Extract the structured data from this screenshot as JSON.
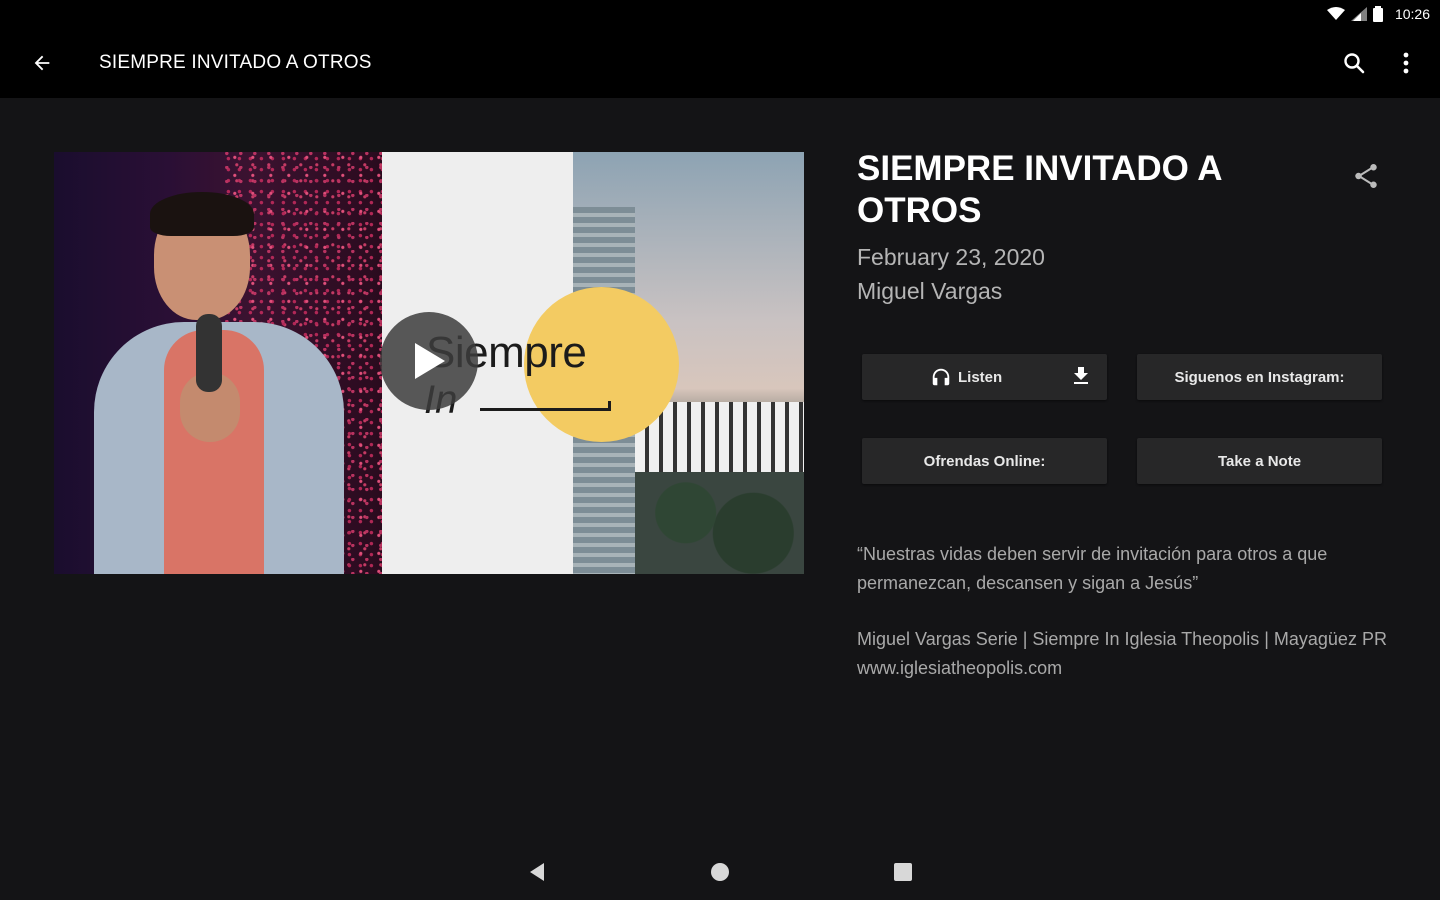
{
  "status_bar": {
    "time": "10:26"
  },
  "app_bar": {
    "title": "SIEMPRE INVITADO A OTROS"
  },
  "hero": {
    "word1": "Siempre",
    "word2": "In"
  },
  "sermon": {
    "title": "SIEMPRE INVITADO A OTROS",
    "date": "February 23, 2020",
    "speaker": "Miguel Vargas"
  },
  "actions": {
    "listen": "Listen",
    "instagram": "Siguenos en Instagram:",
    "ofrendas": "Ofrendas Online:",
    "note": "Take a Note"
  },
  "description": {
    "quote": "“Nuestras vidas deben servir de invitación para otros a que permanezcan, descansen y sigan a Jesús”",
    "series": "Miguel Vargas Serie | Siempre In Iglesia Theopolis | Mayagüez PR www.iglesiatheopolis.com"
  },
  "colors": {
    "background": "#141416",
    "button": "#272728",
    "accent_yellow": "#f3cb62"
  }
}
